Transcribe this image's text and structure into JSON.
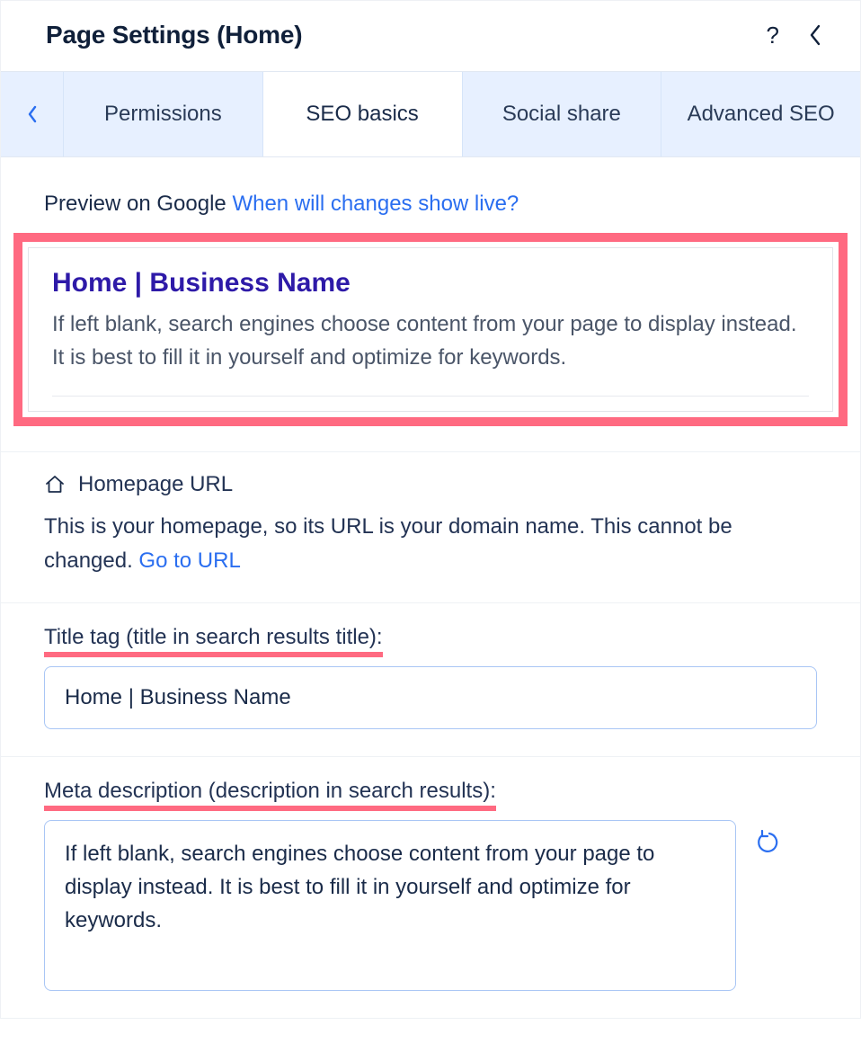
{
  "header": {
    "title": "Page Settings (Home)"
  },
  "tabs": {
    "items": [
      "Permissions",
      "SEO basics",
      "Social share",
      "Advanced SEO"
    ],
    "activeIndex": 1
  },
  "preview": {
    "label": "Preview on Google ",
    "link_text": "When will changes show live?",
    "google_title": "Home | Business Name",
    "google_desc": "If left blank, search engines choose content from your page to display instead. It is best to fill it in yourself and optimize for keywords."
  },
  "homepage_url": {
    "label": "Homepage URL",
    "desc_prefix": "This is your homepage, so its URL is your domain name. This cannot be changed. ",
    "link_text": "Go to URL"
  },
  "title_tag": {
    "label": "Title tag (title in search results title):",
    "value": "Home | Business Name"
  },
  "meta_desc": {
    "label": "Meta description (description in search results):",
    "value": "If left blank, search engines choose content from your page to display instead. It is best to fill it in yourself and optimize for keywords."
  }
}
